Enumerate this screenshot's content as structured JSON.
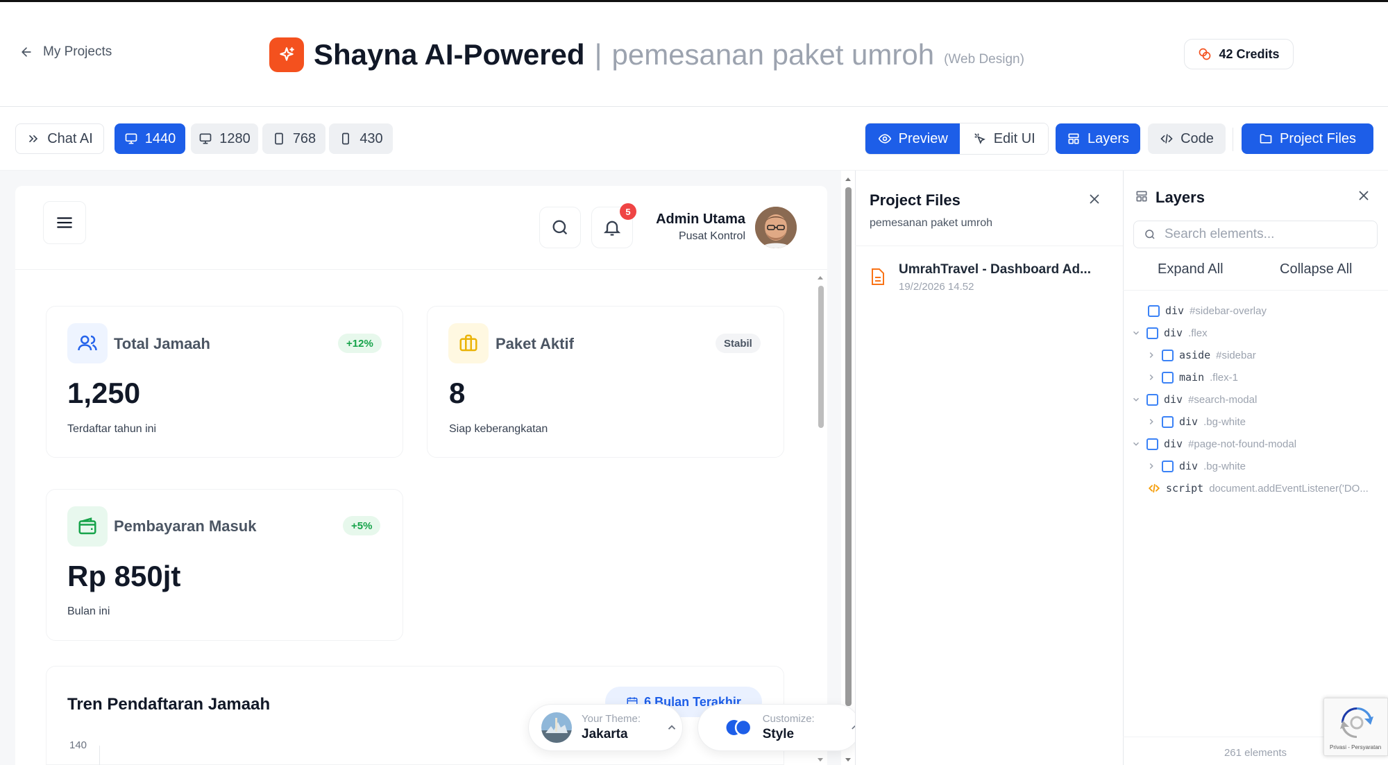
{
  "header": {
    "back_label": "My Projects",
    "brand_name": "Shayna AI-Powered",
    "separator": "|",
    "project_name": "pemesanan paket umroh",
    "project_type": "(Web Design)",
    "credits_label": "42 Credits"
  },
  "toolbar": {
    "chat_ai_label": "Chat AI",
    "viewports": [
      "1440",
      "1280",
      "768",
      "430"
    ],
    "active_viewport": "1440",
    "preview_label": "Preview",
    "edit_ui_label": "Edit UI",
    "layers_label": "Layers",
    "code_label": "Code",
    "project_files_label": "Project Files"
  },
  "preview": {
    "user_name": "Admin Utama",
    "user_role": "Pusat Kontrol",
    "notification_count": "5",
    "cards": [
      {
        "title": "Total Jamaah",
        "badge": "+12%",
        "value": "1,250",
        "subtitle": "Terdaftar tahun ini"
      },
      {
        "title": "Paket Aktif",
        "badge": "Stabil",
        "value": "8",
        "subtitle": "Siap keberangkatan"
      },
      {
        "title": "Pembayaran Masuk",
        "badge": "+5%",
        "value": "Rp 850jt",
        "subtitle": "Bulan ini"
      }
    ],
    "trend_title": "Tren Pendaftaran Jamaah",
    "trend_filter": "6 Bulan Terakhir",
    "chart_first_tick": "140"
  },
  "theme_switcher": {
    "theme_caption": "Your Theme:",
    "theme_value": "Jakarta",
    "customize_caption": "Customize:",
    "customize_value": "Style"
  },
  "project_files_panel": {
    "title": "Project Files",
    "subtitle": "pemesanan paket umroh",
    "files": [
      {
        "name": "UmrahTravel - Dashboard Ad...",
        "date": "19/2/2026 14.52"
      }
    ]
  },
  "layers_panel": {
    "title": "Layers",
    "search_placeholder": "Search elements...",
    "expand_all": "Expand All",
    "collapse_all": "Collapse All",
    "tree": [
      {
        "tag": "div",
        "selector": "#sidebar-overlay"
      },
      {
        "tag": "div",
        "selector": ".flex"
      },
      {
        "tag": "aside",
        "selector": "#sidebar"
      },
      {
        "tag": "main",
        "selector": ".flex-1"
      },
      {
        "tag": "div",
        "selector": "#search-modal"
      },
      {
        "tag": "div",
        "selector": ".bg-white"
      },
      {
        "tag": "div",
        "selector": "#page-not-found-modal"
      },
      {
        "tag": "div",
        "selector": ".bg-white"
      },
      {
        "tag": "script",
        "selector": "document.addEventListener('DO..."
      }
    ],
    "element_count": "261 elements"
  },
  "recaptcha": {
    "text": "Privasi - Persyaratan"
  },
  "colors": {
    "brand": "#f4511e",
    "accent": "#1d5ee8",
    "success": "#16a34a",
    "badge_red": "#ef4444"
  }
}
